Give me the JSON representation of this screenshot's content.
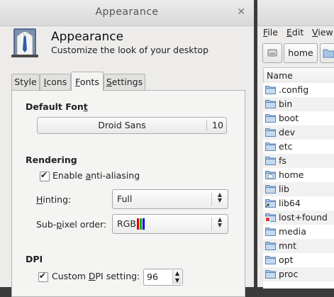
{
  "dialog": {
    "title": "Appearance",
    "header_title": "Appearance",
    "header_subtitle": "Customize the look of your desktop",
    "tabs": [
      {
        "label_pre": "Style",
        "mnemonic": "",
        "label_post": ""
      },
      {
        "label_pre": "",
        "mnemonic": "I",
        "label_post": "cons"
      },
      {
        "label_pre": "",
        "mnemonic": "F",
        "label_post": "onts"
      },
      {
        "label_pre": "",
        "mnemonic": "S",
        "label_post": "ettings"
      }
    ],
    "active_tab": "Fonts",
    "default_font": {
      "heading_pre": "Default Fon",
      "heading_mnemonic": "t",
      "font_name": "Droid Sans",
      "font_size": "10"
    },
    "rendering": {
      "heading": "Rendering",
      "antialias_pre": "Enable ",
      "antialias_mnemonic": "a",
      "antialias_post": "nti-aliasing",
      "antialias_checked": true,
      "hinting_pre": "",
      "hinting_mnemonic": "H",
      "hinting_post": "inting:",
      "hinting_value": "Full",
      "subpixel_pre": "Sub-",
      "subpixel_mnemonic": "p",
      "subpixel_post": "ixel order:",
      "subpixel_value": "RGB",
      "subpixel_colors": [
        "#e00000",
        "#00b000",
        "#0000e0"
      ]
    },
    "dpi": {
      "heading": "DPI",
      "custom_pre": "Custom ",
      "custom_mnemonic": "D",
      "custom_post": "PI setting:",
      "custom_checked": true,
      "value": "96"
    }
  },
  "file_manager": {
    "menu": [
      {
        "pre": "",
        "mnemonic": "F",
        "post": "ile"
      },
      {
        "pre": "",
        "mnemonic": "E",
        "post": "dit"
      },
      {
        "pre": "",
        "mnemonic": "V",
        "post": "iew"
      }
    ],
    "location": "home",
    "column_header": "Name",
    "items": [
      {
        "name": ".config",
        "icon": "folder-icon"
      },
      {
        "name": "bin",
        "icon": "folder-icon"
      },
      {
        "name": "boot",
        "icon": "folder-icon"
      },
      {
        "name": "dev",
        "icon": "folder-icon"
      },
      {
        "name": "etc",
        "icon": "folder-icon"
      },
      {
        "name": "fs",
        "icon": "folder-icon"
      },
      {
        "name": "home",
        "icon": "home-folder-icon"
      },
      {
        "name": "lib",
        "icon": "folder-icon"
      },
      {
        "name": "lib64",
        "icon": "folder-link-icon"
      },
      {
        "name": "lost+found",
        "icon": "folder-locked-icon"
      },
      {
        "name": "media",
        "icon": "folder-icon"
      },
      {
        "name": "mnt",
        "icon": "folder-icon"
      },
      {
        "name": "opt",
        "icon": "folder-icon"
      },
      {
        "name": "proc",
        "icon": "folder-icon"
      }
    ]
  }
}
